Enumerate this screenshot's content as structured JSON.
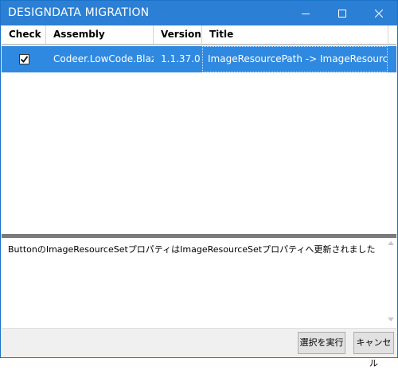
{
  "window": {
    "title": "DESIGNDATA MIGRATION",
    "accent_color": "#2b7fd4",
    "controls": {
      "minimize_icon": "minimize-icon",
      "maximize_icon": "maximize-icon",
      "close_icon": "close-icon"
    }
  },
  "grid": {
    "columns": [
      "Check",
      "Assembly",
      "Version",
      "Title"
    ],
    "rows": [
      {
        "checked": true,
        "assembly": "Codeer.LowCode.Blazor",
        "version": "1.1.37.0",
        "title": "ImageResourcePath -> ImageResourceSet"
      }
    ],
    "selection_color": "#2f89e0"
  },
  "details": {
    "text": "ButtonのImageResourceSetプロパティはImageResourceSetプロパティへ更新されました"
  },
  "buttons": {
    "execute": "選択を実行",
    "cancel": "キャンセル"
  }
}
